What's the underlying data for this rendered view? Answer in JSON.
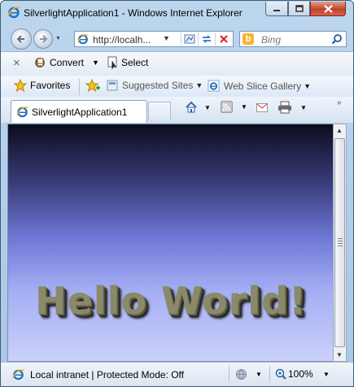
{
  "window": {
    "title": "SilverlightApplication1 - Windows Internet Explorer"
  },
  "navigation": {
    "address": "http://localh...",
    "search_placeholder": "Bing"
  },
  "command_bar": {
    "close_glyph": "×",
    "convert_label": "Convert",
    "select_label": "Select"
  },
  "favorites_bar": {
    "favorites_label": "Favorites",
    "items": [
      {
        "label": "Suggested Sites"
      },
      {
        "label": "Web Slice Gallery"
      }
    ]
  },
  "tabs": [
    {
      "label": "SilverlightApplication1"
    }
  ],
  "content": {
    "text": "Hello World!"
  },
  "status_bar": {
    "zone_text": "Local intranet | Protected Mode: Off",
    "zoom": "100%"
  }
}
